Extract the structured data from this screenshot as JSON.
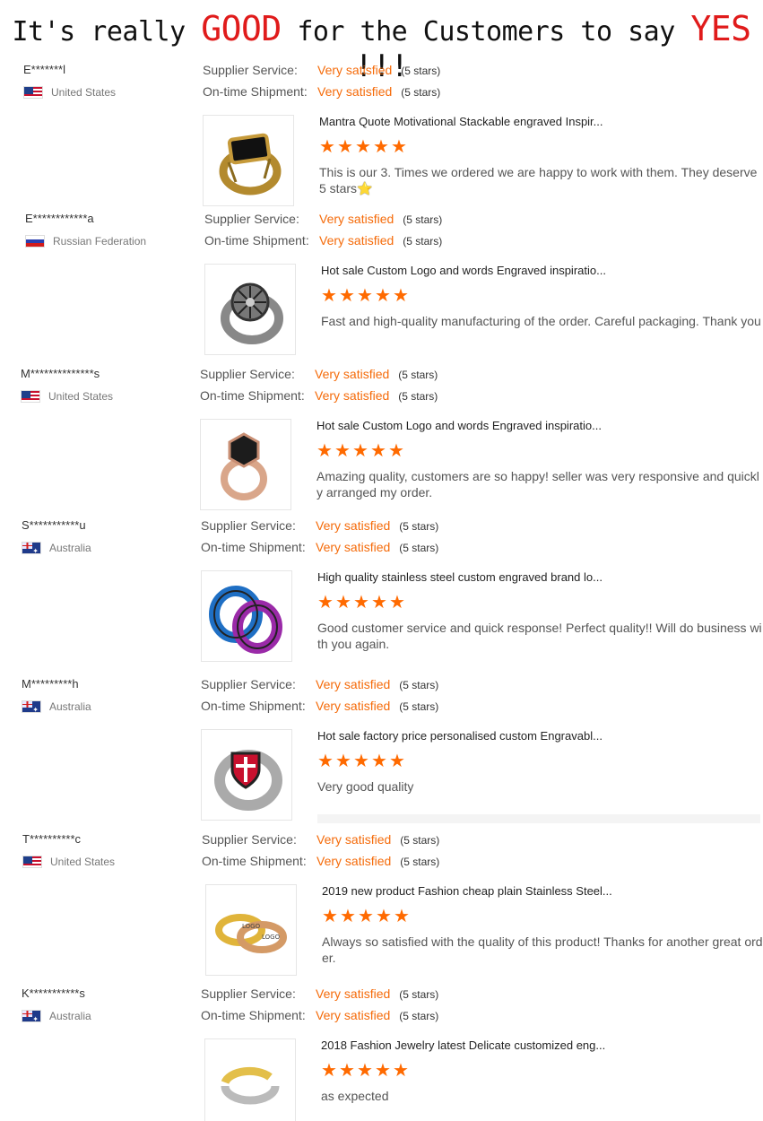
{
  "banner": {
    "prefix": "It's really",
    "good": "GOOD",
    "middle": "for the Customers to say",
    "yes": "YES",
    "suffix": "!!!"
  },
  "labels": {
    "supplier_service": "Supplier Service:",
    "ontime_shipment": "On-time Shipment:"
  },
  "reviews": [
    {
      "buyer": "E*******l",
      "country": "United States",
      "flag": "us",
      "supplier_value": "Very satisfied",
      "supplier_count": "(5 stars)",
      "shipment_value": "Very satisfied",
      "shipment_count": "(5 stars)",
      "product_title": "Mantra Quote Motivational Stackable engraved Inspir...",
      "rating": 5,
      "comment": "This is our 3. Times we ordered we are happy to work with them. They deserve 5 stars",
      "comment_emoji": "⭐",
      "thumb_icon": "black-stone-gold-ring"
    },
    {
      "buyer": "E************a",
      "country": "Russian Federation",
      "flag": "ru",
      "supplier_value": "Very satisfied",
      "supplier_count": "(5 stars)",
      "shipment_value": "Very satisfied",
      "shipment_count": "(5 stars)",
      "product_title": "Hot sale Custom Logo and words Engraved inspiratio...",
      "rating": 5,
      "comment": "Fast and high-quality manufacturing of the order. Careful packaging. Thank you",
      "thumb_icon": "viking-compass-ring"
    },
    {
      "buyer": "M**************s",
      "country": "United States",
      "flag": "us",
      "supplier_value": "Very satisfied",
      "supplier_count": "(5 stars)",
      "shipment_value": "Very satisfied",
      "shipment_count": "(5 stars)",
      "product_title": "Hot sale Custom Logo and words Engraved inspiratio...",
      "rating": 5,
      "comment": "Amazing quality, customers are so happy! seller was very responsive and quickly arranged my order.",
      "thumb_icon": "rose-gold-signet-ring"
    },
    {
      "buyer": "S***********u",
      "country": "Australia",
      "flag": "au",
      "supplier_value": "Very satisfied",
      "supplier_count": "(5 stars)",
      "shipment_value": "Very satisfied",
      "shipment_count": "(5 stars)",
      "product_title": "High quality stainless steel custom engraved brand lo...",
      "rating": 5,
      "comment": "Good customer service and quick response! Perfect quality!! Will do business with you again.",
      "thumb_icon": "blue-purple-couple-rings"
    },
    {
      "buyer": "M*********h",
      "country": "Australia",
      "flag": "au",
      "supplier_value": "Very satisfied",
      "supplier_count": "(5 stars)",
      "shipment_value": "Very satisfied",
      "shipment_count": "(5 stars)",
      "product_title": "Hot sale factory price personalised custom Engravabl...",
      "rating": 5,
      "comment": "Very good quality",
      "thumb_icon": "red-shield-cross-ring"
    },
    {
      "buyer": "T**********c",
      "country": "United States",
      "flag": "us",
      "supplier_value": "Very satisfied",
      "supplier_count": "(5 stars)",
      "shipment_value": "Very satisfied",
      "shipment_count": "(5 stars)",
      "product_title": "2019 new product Fashion cheap plain Stainless Steel...",
      "rating": 5,
      "comment": "Always so satisfied with the quality of this product! Thanks for another great order.",
      "thumb_icon": "gold-logo-band-rings",
      "thumb_text": "LOGO"
    },
    {
      "buyer": "K***********s",
      "country": "Australia",
      "flag": "au",
      "supplier_value": "Very satisfied",
      "supplier_count": "(5 stars)",
      "shipment_value": "Very satisfied",
      "shipment_count": "(5 stars)",
      "product_title": "2018 Fashion Jewelry latest Delicate customized eng...",
      "rating": 5,
      "comment": "as expected",
      "thumb_icon": "open-cuff-engraved-ring"
    }
  ],
  "colors": {
    "accent": "#f56b0a",
    "star": "#ff6a00",
    "banner_highlight": "#e01b1b"
  }
}
